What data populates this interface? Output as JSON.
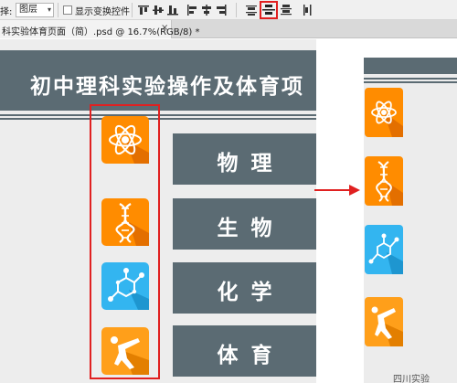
{
  "options_bar": {
    "auto_select_label": "择:",
    "auto_select_value": "图层",
    "show_transform_label": "显示变换控件",
    "align_icons": [
      "align-top-icon",
      "align-vertical-center-icon",
      "align-bottom-icon",
      "align-left-icon",
      "align-horizontal-center-icon",
      "align-right-icon"
    ],
    "distribute_icons": [
      "distribute-top-icon",
      "distribute-vertical-center-icon",
      "distribute-bottom-icon",
      "distribute-left-icon"
    ],
    "highlighted_icon": "distribute-vertical-center-icon"
  },
  "document_tab": {
    "title": "科实验体育页面（简）.psd @ 16.7%(RGB/8) *",
    "close_glyph": "×"
  },
  "canvas": {
    "title": "初中理科实验操作及体育项",
    "subjects": [
      "物理",
      "生物",
      "化学",
      "体育"
    ],
    "icons": [
      "atom-icon",
      "dna-icon",
      "molecule-icon",
      "martial-arts-kick-icon"
    ]
  },
  "preview": {
    "icons": [
      "atom-icon",
      "dna-icon",
      "molecule-icon",
      "martial-arts-kick-icon"
    ],
    "caption": "四川实验"
  },
  "colors": {
    "slate": "#5b6b73",
    "orange": "#ff8c00",
    "cyan": "#33b5f0",
    "highlight_red": "#e02020"
  }
}
